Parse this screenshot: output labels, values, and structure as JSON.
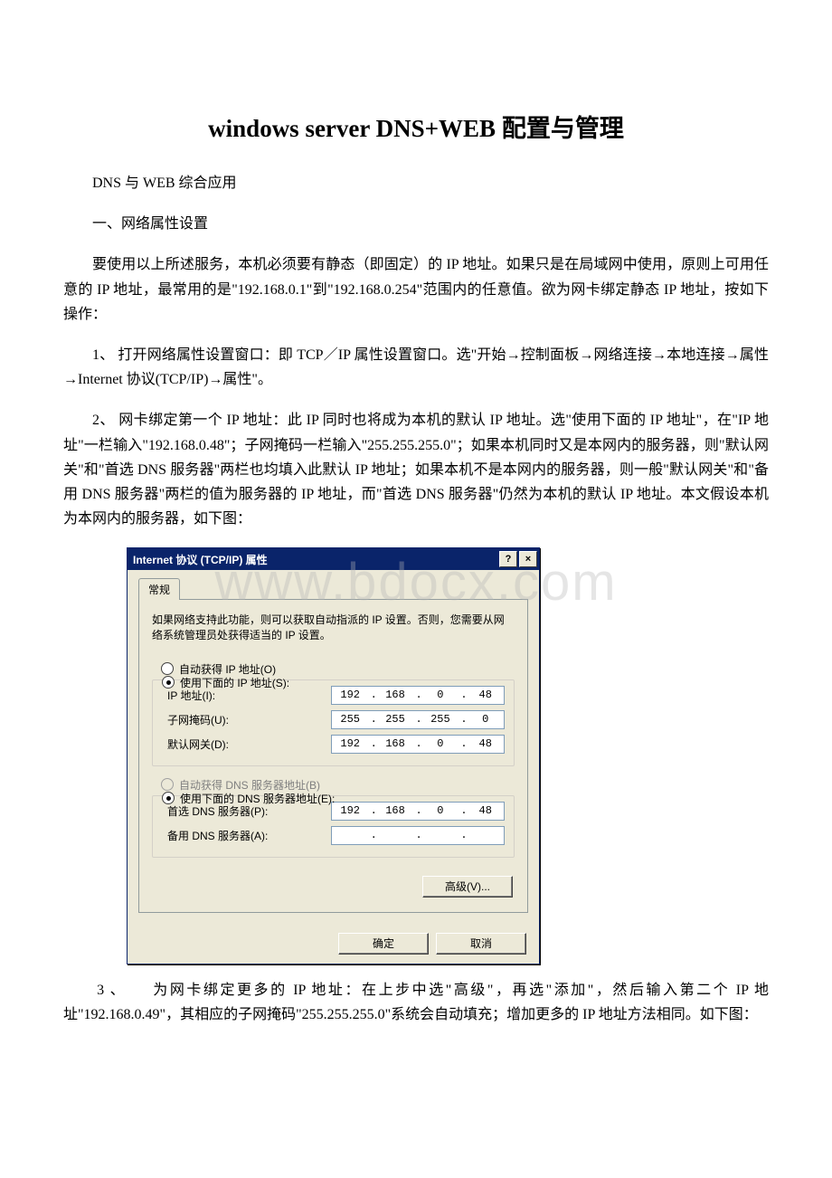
{
  "title": "windows server DNS+WEB 配置与管理",
  "p1": "DNS 与 WEB 综合应用",
  "p2": "一、网络属性设置",
  "p3": "要使用以上所述服务，本机必须要有静态（即固定）的 IP 地址。如果只是在局域网中使用，原则上可用任意的 IP 地址，最常用的是\"192.168.0.1\"到\"192.168.0.254\"范围内的任意值。欲为网卡绑定静态 IP 地址，按如下操作：",
  "p4": "1、 打开网络属性设置窗口：即 TCP／IP 属性设置窗口。选\"开始→控制面板→网络连接→本地连接→属性→Internet 协议(TCP/IP)→属性\"。",
  "p5": "2、 网卡绑定第一个 IP 地址：此 IP 同时也将成为本机的默认 IP 地址。选\"使用下面的 IP 地址\"，在\"IP 地址\"一栏输入\"192.168.0.48\"；子网掩码一栏输入\"255.255.255.0\"；如果本机同时又是本网内的服务器，则\"默认网关\"和\"首选 DNS 服务器\"两栏也均填入此默认 IP 地址；如果本机不是本网内的服务器，则一般\"默认网关\"和\"备用 DNS 服务器\"两栏的值为服务器的 IP 地址，而\"首选 DNS 服务器\"仍然为本机的默认 IP 地址。本文假设本机为本网内的服务器，如下图：",
  "p6": "　　3 、　　为网卡绑定更多的 IP 地址：在上步中选\"高级\"，再选\"添加\"，然后输入第二个 IP 地址\"192.168.0.49\"，其相应的子网掩码\"255.255.255.0\"系统会自动填充；增加更多的 IP 地址方法相同。如下图：",
  "watermark": "www.bdocx.com",
  "dialog": {
    "title": "Internet 协议 (TCP/IP) 属性",
    "help": "?",
    "close": "×",
    "tab": "常规",
    "description": "如果网络支持此功能，则可以获取自动指派的 IP 设置。否则，您需要从网络系统管理员处获得适当的 IP 设置。",
    "radio_auto_ip": "自动获得 IP 地址(O)",
    "radio_manual_ip": "使用下面的 IP 地址(S):",
    "label_ip": "IP 地址(I):",
    "label_subnet": "子网掩码(U):",
    "label_gateway": "默认网关(D):",
    "ip": [
      "192",
      "168",
      "0",
      "48"
    ],
    "subnet": [
      "255",
      "255",
      "255",
      "0"
    ],
    "gateway": [
      "192",
      "168",
      "0",
      "48"
    ],
    "radio_auto_dns": "自动获得 DNS 服务器地址(B)",
    "radio_manual_dns": "使用下面的 DNS 服务器地址(E):",
    "label_dns1": "首选 DNS 服务器(P):",
    "label_dns2": "备用 DNS 服务器(A):",
    "dns1": [
      "192",
      "168",
      "0",
      "48"
    ],
    "dns2": [
      "",
      "",
      "",
      ""
    ],
    "btn_adv": "高级(V)...",
    "btn_ok": "确定",
    "btn_cancel": "取消"
  }
}
